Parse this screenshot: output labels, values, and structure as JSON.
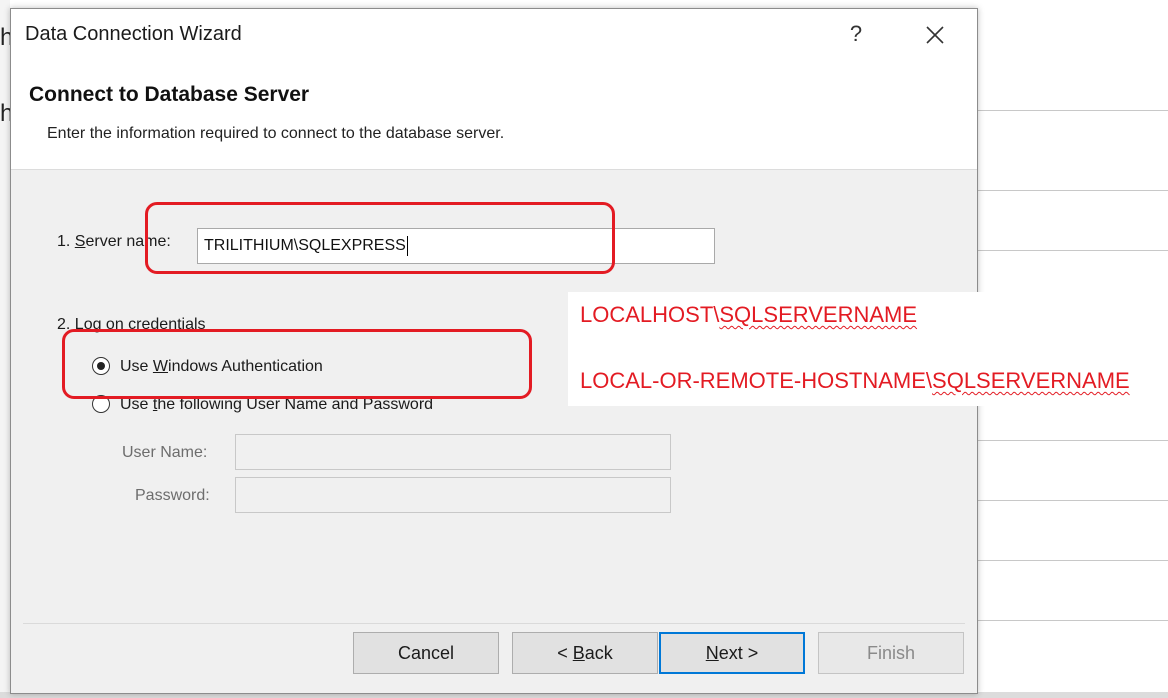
{
  "dialog": {
    "title": "Data Connection Wizard",
    "help_label": "?",
    "page_title": "Connect to Database Server",
    "page_subtitle": "Enter the information required to connect to the database server."
  },
  "server": {
    "step_prefix": "1. ",
    "label_accel": "S",
    "label_rest": "erver name:",
    "value": "TRILITHIUM\\SQLEXPRESS"
  },
  "credentials": {
    "step_label": "2. Log on credentials",
    "windows_auth": {
      "prefix": "Use ",
      "accel": "W",
      "rest": "indows Authentication",
      "selected": true
    },
    "userpass": {
      "prefix": "Use ",
      "accel": "t",
      "rest": "he following User Name and Password",
      "selected": false
    },
    "username_label": "User Name:",
    "username_value": "",
    "password_label": "Password:",
    "password_value": ""
  },
  "buttons": {
    "cancel": "Cancel",
    "back_prefix": "< ",
    "back_accel": "B",
    "back_rest": "ack",
    "next_accel": "N",
    "next_rest": "ext >",
    "finish": "Finish"
  },
  "annotations": {
    "line1_prefix": "LOCALHOST\\",
    "line1_suffix": "SQLSERVERNAME",
    "line2_prefix": "LOCAL-OR-REMOTE-HOSTNAME\\",
    "line2_suffix": "SQLSERVERNAME",
    "color": "#e31b23"
  },
  "colors": {
    "dialog_bg": "#f0f0f0",
    "accent": "#0078d7"
  }
}
